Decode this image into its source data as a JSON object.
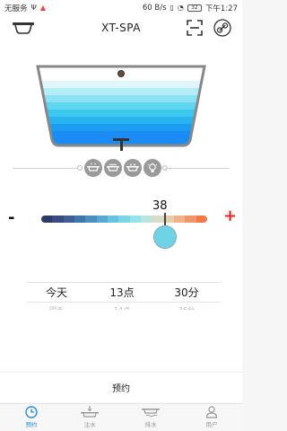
{
  "status_bar": {
    "carrier": "无服务",
    "speed": "60 B/s",
    "battery": "32",
    "time": "下午1:27"
  },
  "app_bar": {
    "title": "XT-SPA",
    "left_icon": "bathtub-icon",
    "scan_icon": "scan-icon",
    "link_icon": "link-icon"
  },
  "modes": [
    {
      "name": "bathtub-mode-1-icon"
    },
    {
      "name": "bathtub-mode-2-icon"
    },
    {
      "name": "bathtub-mode-3-icon"
    },
    {
      "name": "light-bulb-icon"
    }
  ],
  "temperature": {
    "value": "38",
    "minus": "-",
    "plus": "+",
    "gradient": [
      "#2e3a66",
      "#3a4a80",
      "#3d5f95",
      "#3f77aa",
      "#4a8fbf",
      "#58a9d1",
      "#69c2df",
      "#7dd6e8",
      "#94e3ea",
      "#b8e6df",
      "#d9ddc8",
      "#e8cba8",
      "#efb08a",
      "#f29568",
      "#f47a45"
    ]
  },
  "schedule": {
    "day": "今天",
    "hour": "13点",
    "minute": "30分",
    "day_next": "明天",
    "hour_next": "14点",
    "minute_next": "35分"
  },
  "book_button": "预约",
  "tabs": [
    {
      "label": "预约",
      "icon": "clock-icon",
      "active": true
    },
    {
      "label": "注水",
      "icon": "fill-water-icon",
      "active": false
    },
    {
      "label": "排水",
      "icon": "drain-water-icon",
      "active": false
    },
    {
      "label": "用户",
      "icon": "user-icon",
      "active": false
    }
  ],
  "colors": {
    "accent": "#2a8fd8",
    "water": "#38c6ea",
    "plus": "#ee2222"
  }
}
